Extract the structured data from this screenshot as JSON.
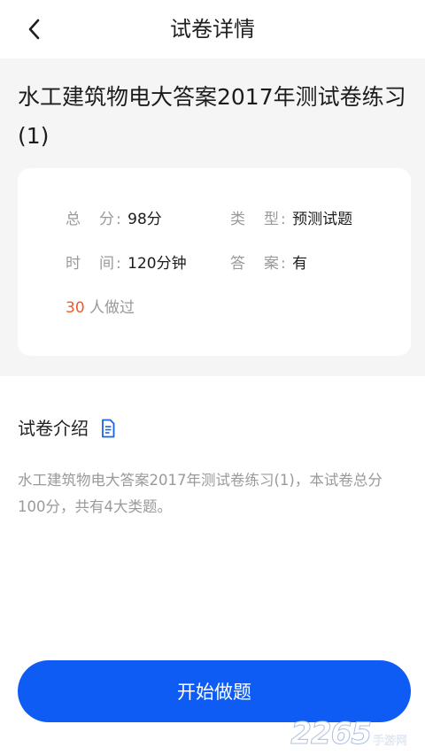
{
  "header": {
    "title": "试卷详情"
  },
  "paper": {
    "title": "水工建筑物电大答案2017年测试卷练习(1)"
  },
  "info": {
    "score_label": "总　分:",
    "score_value": "98分",
    "type_label": "类　型:",
    "type_value": "预测试题",
    "time_label": "时　间:",
    "time_value": "120分钟",
    "answer_label": "答　案:",
    "answer_value": "有",
    "done_count": "30",
    "done_text": "人做过"
  },
  "intro": {
    "heading": "试卷介绍",
    "icon": "document-icon",
    "text": "水工建筑物电大答案2017年测试卷练习(1)，本试卷总分100分，共有4大类题。"
  },
  "actions": {
    "start_label": "开始做题"
  },
  "watermark": {
    "number": "2265",
    "text": "手游网"
  },
  "colors": {
    "primary": "#0e5cf4",
    "accent_count": "#f15a2b",
    "muted_text": "#9a9a9a",
    "section_bg": "#f5f5f5"
  }
}
